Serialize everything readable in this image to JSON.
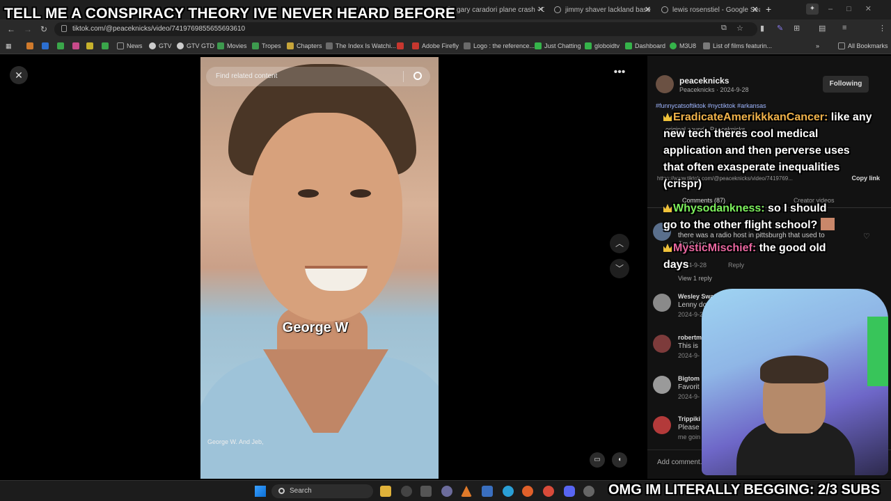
{
  "overlays": {
    "top_text": "TELL ME A CONSPIRACY THEORY IVE NEVER HEARD BEFORE",
    "bottom_text": "OMG IM LITERALLY BEGGING: 2/3 SUBS"
  },
  "browser": {
    "tabs": [
      {
        "title": "gary caradori plane crash - Go"
      },
      {
        "title": "jimmy shaver lackland base - C"
      },
      {
        "title": "lewis rosenstiel - Google Sear"
      }
    ],
    "url": "tiktok.com/@peaceknicks/video/7419769855655693610",
    "profile_initial": "g"
  },
  "bookmarks": [
    {
      "label": "News",
      "color": "#7a7a7a"
    },
    {
      "label": "GTV",
      "color": "#cccccc"
    },
    {
      "label": "GTV GTD",
      "color": "#cccccc"
    },
    {
      "label": "Movies",
      "color": "#3d9a4e"
    },
    {
      "label": "Tropes",
      "color": "#3d9a4e"
    },
    {
      "label": "Chapters",
      "color": "#c7a53a"
    },
    {
      "label": "The Index Is Watchi...",
      "color": "#6b6b6b"
    },
    {
      "label": "",
      "color": "#c7372f"
    },
    {
      "label": "Adobe Firefly",
      "color": "#c7372f"
    },
    {
      "label": "Logo : the reference...",
      "color": "#6b6b6b"
    },
    {
      "label": "Just Chatting",
      "color": "#35b34a"
    },
    {
      "label": "globoidtv",
      "color": "#35b34a"
    },
    {
      "label": "Dashboard",
      "color": "#35b34a"
    },
    {
      "label": "M3U8",
      "color": "#35b34a"
    },
    {
      "label": "List of films featurin...",
      "color": "#7a7a7a"
    },
    {
      "label": "All Bookmarks",
      "color": "#7a7a7a"
    }
  ],
  "video": {
    "search_placeholder": "Find related content",
    "caption_main": "George W",
    "caption_sub": "George W. And Jeb,"
  },
  "panel": {
    "username": "peaceknicks",
    "subline": "Peaceknicks · 2024-9-28",
    "follow_label": "Following",
    "tags": "#funnycatsoftiktok #nyctiktok #arkansas",
    "sound": "original sound - Peaceknicks",
    "link_url": "https://www.tiktok.com/@peaceknicks/video/7419769...",
    "copy_link": "Copy link",
    "tab_comments": "Comments (87)",
    "tab_creator": "Creator videos",
    "add_comment_placeholder": "Add comment...",
    "view_reply": "View 1 reply",
    "comments": [
      {
        "name": "Jim Quinn",
        "text": "there was a radio host in pittsburgh that used to",
        "date": "2024-9-28",
        "reply": "Reply",
        "avatar_color": "#5a6f8c"
      },
      {
        "name": "Wesley Swafford",
        "text": "Lenny don't",
        "date": "2024-9-28",
        "reply": "",
        "avatar_color": "#8a8a8a"
      },
      {
        "name": "robertm",
        "text": "This is",
        "date": "2024-9-",
        "reply": "",
        "avatar_color": "#7d3b3b"
      },
      {
        "name": "Bigtom",
        "text": "Favorit",
        "date": "2024-9-",
        "reply": "",
        "avatar_color": "#9a9a9a"
      },
      {
        "name": "Trippiki",
        "text": "Please",
        "date": "me goin",
        "reply": "",
        "avatar_color": "#b33a3a"
      }
    ]
  },
  "chat": [
    {
      "name": "EradicateAmerikkkanCancer:",
      "text_lines": [
        "like any",
        "new tech theres cool medical",
        "application and then perverse uses",
        "that often exasperate inequalities",
        "(crispr)"
      ]
    },
    {
      "name": "Whysodankness:",
      "text_lines": [
        "so I should",
        "go to the other flight school?"
      ]
    },
    {
      "name": "MysticMischief:",
      "text_lines": [
        "the good old",
        "days"
      ]
    }
  ],
  "taskbar": {
    "search_label": "Search"
  }
}
